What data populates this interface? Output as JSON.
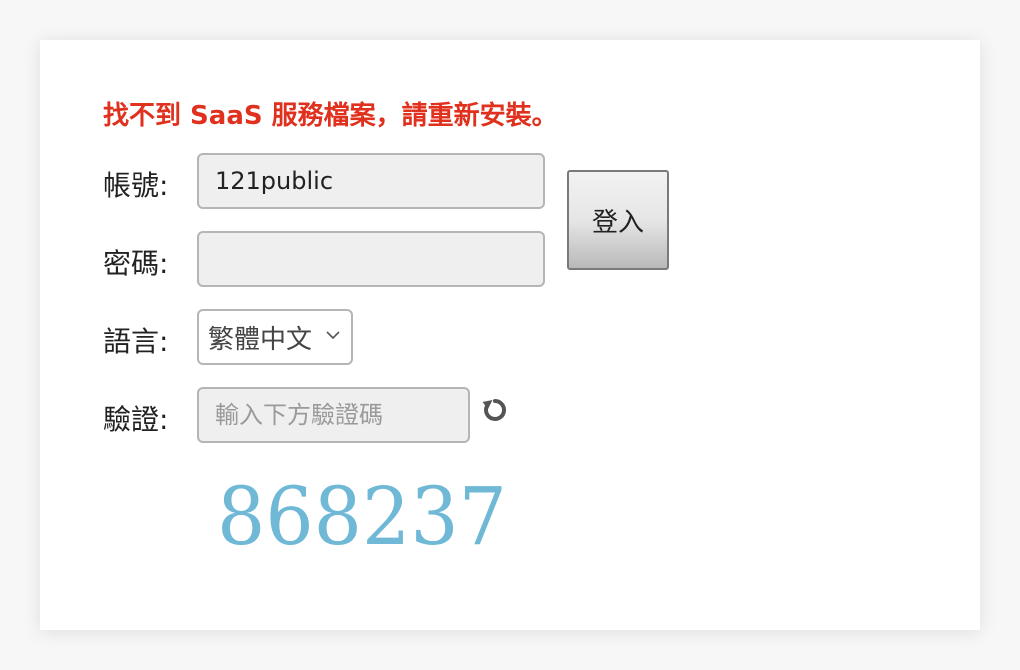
{
  "error_message": "找不到 SaaS 服務檔案，請重新安裝。",
  "form": {
    "account_label": "帳號:",
    "account_value": "121public",
    "password_label": "密碼:",
    "password_value": "",
    "language_label": "語言:",
    "language_selected": "繁體中文",
    "captcha_label": "驗證:",
    "captcha_placeholder": "輸入下方驗證碼",
    "captcha_image_text": "868237"
  },
  "login_button_label": "登入",
  "icons": {
    "refresh": "refresh-icon",
    "dropdown": "chevron-down-icon"
  },
  "colors": {
    "error": "#e0301e",
    "captcha": "#6fb8d6"
  }
}
